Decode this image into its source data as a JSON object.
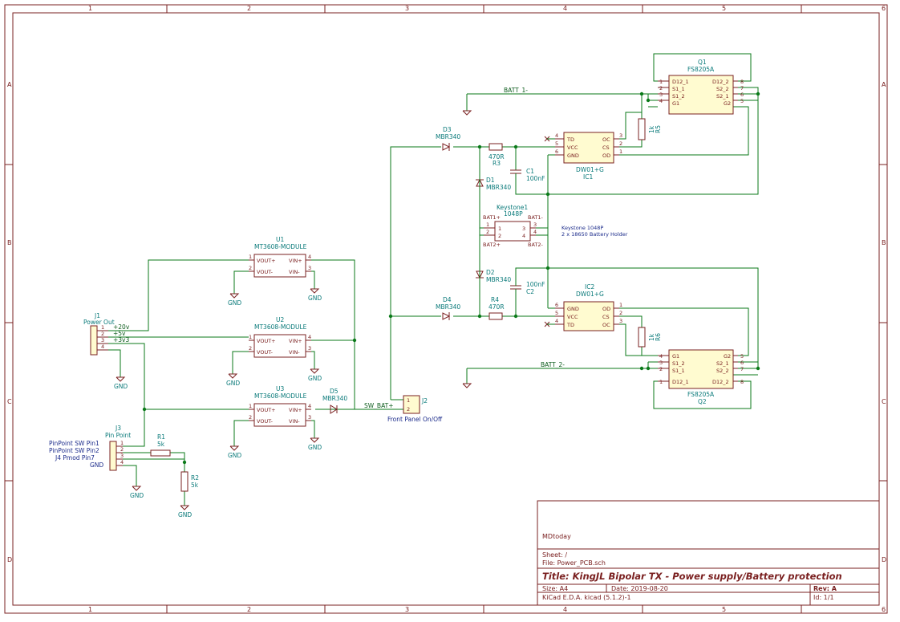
{
  "frame": {
    "columns": [
      "1",
      "2",
      "3",
      "4",
      "5",
      "6"
    ],
    "rows": [
      "A",
      "B",
      "C",
      "D"
    ]
  },
  "nets": {
    "batt1": "BATT_1-",
    "batt2": "BATT_2-",
    "swbat": "SW_BAT+",
    "p20v": "+20v",
    "p5v": "+5v",
    "p3v3": "+3v3",
    "gnd": "GND"
  },
  "components": {
    "u1": {
      "ref": "U1",
      "value": "MT3608-MODULE",
      "pins": [
        "VOUT+",
        "VOUT-",
        "VIN+",
        "VIN-"
      ]
    },
    "u2": {
      "ref": "U2",
      "value": "MT3608-MODULE",
      "pins": [
        "VOUT+",
        "VOUT-",
        "VIN+",
        "VIN-"
      ]
    },
    "u3": {
      "ref": "U3",
      "value": "MT3608-MODULE",
      "pins": [
        "VOUT+",
        "VOUT-",
        "VIN+",
        "VIN-"
      ]
    },
    "j1": {
      "ref": "J1",
      "value": "Power Out"
    },
    "j2": {
      "ref": "J2",
      "value": "Front Panel On/Off"
    },
    "j3": {
      "ref": "J3",
      "value": "Pin Point",
      "labels": [
        "PinPoint SW Pin1",
        "PinPoint SW Pin2",
        "J4 Pmod Pin7",
        "GND"
      ]
    },
    "r1": {
      "ref": "R1",
      "value": "5k"
    },
    "r2": {
      "ref": "R2",
      "value": "5k"
    },
    "r3": {
      "ref": "R3",
      "value": "470R"
    },
    "r4": {
      "ref": "R4",
      "value": "470R"
    },
    "r5": {
      "ref": "R5",
      "value": "1k"
    },
    "r6": {
      "ref": "R6",
      "value": "1k"
    },
    "c1": {
      "ref": "C1",
      "value": "100nF"
    },
    "c2": {
      "ref": "C2",
      "value": "100nF"
    },
    "d1": {
      "ref": "D1",
      "value": "MBR340"
    },
    "d2": {
      "ref": "D2",
      "value": "MBR340"
    },
    "d3": {
      "ref": "D3",
      "value": "MBR340"
    },
    "d4": {
      "ref": "D4",
      "value": "MBR340"
    },
    "d5": {
      "ref": "D5",
      "value": "MBR340"
    },
    "ic1": {
      "ref": "IC1",
      "value": "DW01+G",
      "pins": [
        "TD",
        "VCC",
        "GND",
        "OC",
        "CS",
        "OD"
      ]
    },
    "ic2": {
      "ref": "IC2",
      "value": "DW01+G",
      "pins": [
        "GND",
        "VCC",
        "TD",
        "OD",
        "CS",
        "OC"
      ]
    },
    "q1": {
      "ref": "Q1",
      "value": "FS8205A",
      "pins_left": [
        "D12_1",
        "S1_1",
        "S1_2",
        "G1"
      ],
      "pins_right": [
        "D12_2",
        "S2_2",
        "S2_1",
        "G2"
      ]
    },
    "q2": {
      "ref": "Q2",
      "value": "FS8205A",
      "pins_left": [
        "G1",
        "S1_2",
        "S1_1",
        "D12_1"
      ],
      "pins_right": [
        "G2",
        "S2_1",
        "S2_2",
        "D12_2"
      ]
    },
    "keystone": {
      "ref": "Keystone1",
      "value": "1048P",
      "pins": [
        "BAT1+",
        "BAT1-",
        "BAT2+",
        "BAT2-"
      ]
    }
  },
  "note": {
    "line1": "Keystone 1048P",
    "line2": "2 x 18650 Battery Holder"
  },
  "title_block": {
    "company": "MDtoday",
    "sheet": "Sheet: /",
    "file": "File: Power_PCB.sch",
    "title": "Title: KingJL Bipolar TX - Power supply/Battery protection",
    "size": "Size: A4",
    "date": "Date: 2019-08-20",
    "rev": "Rev: A",
    "tool": "KiCad E.D.A.  kicad (5.1.2)-1",
    "id": "Id: 1/1"
  }
}
